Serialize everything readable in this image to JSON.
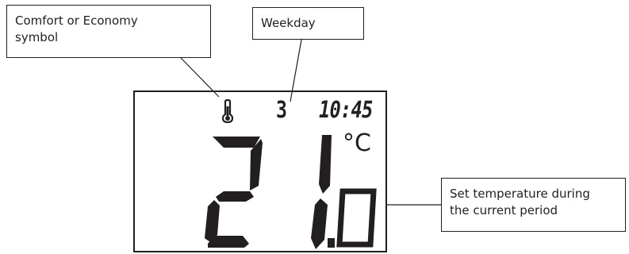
{
  "callouts": {
    "symbol": {
      "line1": "Comfort or Economy",
      "line2": "symbol"
    },
    "weekday": {
      "label": "Weekday"
    },
    "temperature": {
      "line1": "Set temperature during",
      "line2": "the current period"
    }
  },
  "display": {
    "weekday_number": "3",
    "time": "10:45",
    "temperature_integer": "21",
    "temperature_decimal": "0",
    "unit": "°C",
    "mode_icon": "thermometer-icon"
  },
  "colors": {
    "ink": "#231f20",
    "background": "#ffffff"
  }
}
